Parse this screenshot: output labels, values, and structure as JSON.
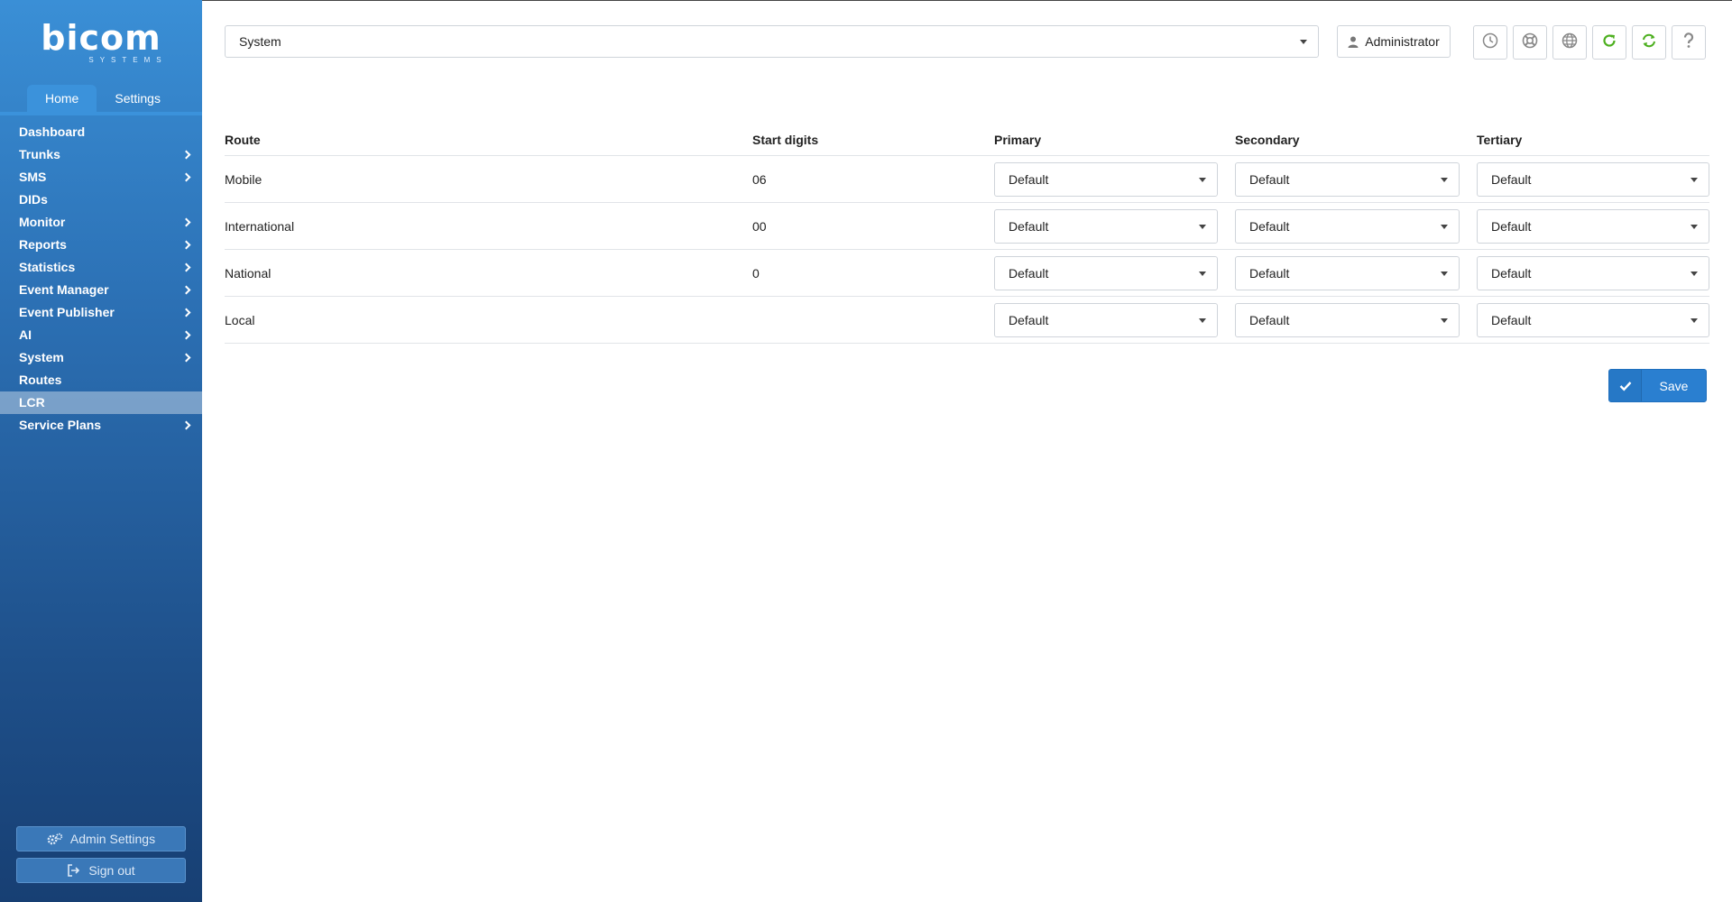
{
  "brand": {
    "logo_text": "bicom",
    "logo_sub": "SYSTEMS"
  },
  "nav_tabs": [
    {
      "label": "Home",
      "active": true
    },
    {
      "label": "Settings",
      "active": false
    }
  ],
  "menu": [
    {
      "label": "Dashboard",
      "has_children": false,
      "active": false
    },
    {
      "label": "Trunks",
      "has_children": true,
      "active": false
    },
    {
      "label": "SMS",
      "has_children": true,
      "active": false
    },
    {
      "label": "DIDs",
      "has_children": false,
      "active": false
    },
    {
      "label": "Monitor",
      "has_children": true,
      "active": false
    },
    {
      "label": "Reports",
      "has_children": true,
      "active": false
    },
    {
      "label": "Statistics",
      "has_children": true,
      "active": false
    },
    {
      "label": "Event Manager",
      "has_children": true,
      "active": false
    },
    {
      "label": "Event Publisher",
      "has_children": true,
      "active": false
    },
    {
      "label": "AI",
      "has_children": true,
      "active": false
    },
    {
      "label": "System",
      "has_children": true,
      "active": false
    },
    {
      "label": "Routes",
      "has_children": false,
      "active": false
    },
    {
      "label": "LCR",
      "has_children": false,
      "active": true
    },
    {
      "label": "Service Plans",
      "has_children": true,
      "active": false
    }
  ],
  "sidebar_buttons": {
    "admin_settings": "Admin Settings",
    "sign_out": "Sign out"
  },
  "topbar": {
    "tenant_select": "System",
    "user_label": "Administrator",
    "icons": [
      "clock-icon",
      "lifebuoy-icon",
      "globe-icon",
      "reload-icon",
      "sync-icon",
      "help-icon"
    ]
  },
  "table": {
    "headers": {
      "route": "Route",
      "start_digits": "Start digits",
      "primary": "Primary",
      "secondary": "Secondary",
      "tertiary": "Tertiary"
    },
    "rows": [
      {
        "route": "Mobile",
        "start_digits": "06",
        "primary": "Default",
        "secondary": "Default",
        "tertiary": "Default"
      },
      {
        "route": "International",
        "start_digits": "00",
        "primary": "Default",
        "secondary": "Default",
        "tertiary": "Default"
      },
      {
        "route": "National",
        "start_digits": "0",
        "primary": "Default",
        "secondary": "Default",
        "tertiary": "Default"
      },
      {
        "route": "Local",
        "start_digits": "",
        "primary": "Default",
        "secondary": "Default",
        "tertiary": "Default"
      }
    ]
  },
  "save_label": "Save",
  "colors": {
    "accent": "#2a7fd0",
    "green_icon": "#4caf1e",
    "sidebar_top": "#3a8fd6",
    "sidebar_bottom": "#173f73"
  }
}
